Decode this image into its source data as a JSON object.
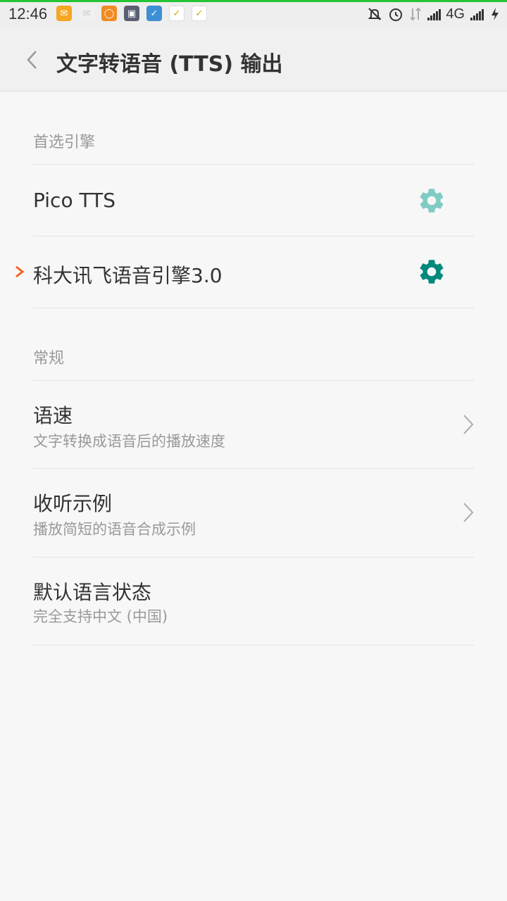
{
  "status_bar": {
    "time": "12:46",
    "network_type": "4G",
    "notification_icons": [
      "mail-icon",
      "gmail-icon",
      "chat-icon",
      "bank-icon",
      "check-app-icon",
      "task-icon",
      "task-icon"
    ],
    "system_icons": [
      "mute-icon",
      "alarm-icon",
      "data-transfer-icon",
      "signal-icon",
      "signal-icon",
      "charging-icon"
    ]
  },
  "header": {
    "title": "文字转语音 (TTS) 输出"
  },
  "preferred_engine": {
    "label": "首选引擎",
    "engines": [
      {
        "name": "Pico TTS",
        "selected": false,
        "gear_color": "#80cbc4"
      },
      {
        "name": "科大讯飞语音引擎3.0",
        "selected": true,
        "gear_color": "#00897b"
      }
    ]
  },
  "general": {
    "label": "常规",
    "items": [
      {
        "title": "语速",
        "subtitle": "文字转换成语音后的播放速度",
        "has_chevron": true
      },
      {
        "title": "收听示例",
        "subtitle": "播放简短的语音合成示例",
        "has_chevron": true
      },
      {
        "title": "默认语言状态",
        "subtitle": "完全支持中文 (中国)",
        "has_chevron": false
      }
    ]
  },
  "colors": {
    "accent": "#00897b",
    "selected_indicator": "#f26522",
    "status_bar_line": "#22c533"
  }
}
